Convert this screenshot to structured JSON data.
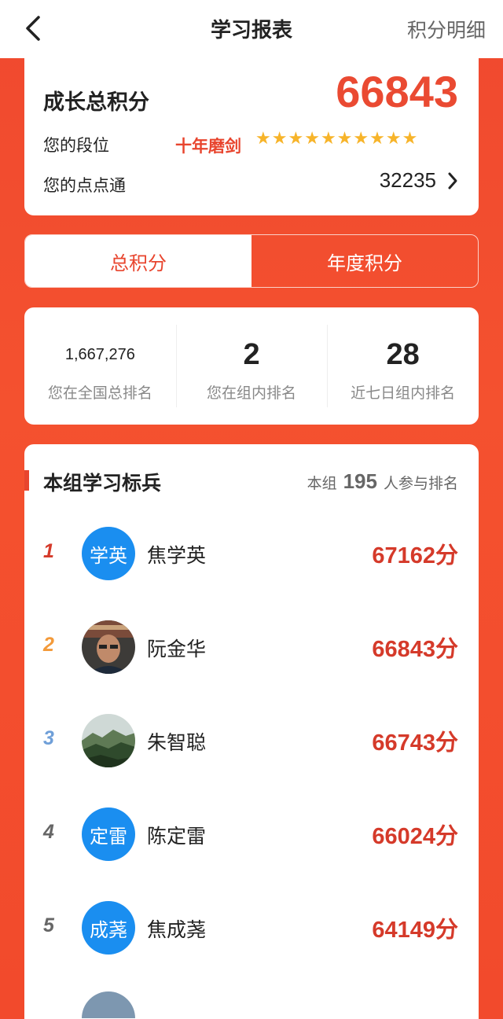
{
  "header": {
    "title": "学习报表",
    "detail_link": "积分明细"
  },
  "summary": {
    "total_label": "成长总积分",
    "total_value": "66843",
    "rank_label": "您的段位",
    "rank_title": "十年磨剑",
    "star_count": 10,
    "points_label": "您的点点通",
    "points_value": "32235"
  },
  "tabs": [
    {
      "label": "总积分",
      "active": true
    },
    {
      "label": "年度积分",
      "active": false
    }
  ],
  "rankings": [
    {
      "value": "1,667,276",
      "caption": "您在全国总排名"
    },
    {
      "value": "2",
      "caption": "您在组内排名"
    },
    {
      "value": "28",
      "caption": "近七日组内排名"
    }
  ],
  "leaderboard": {
    "title": "本组学习标兵",
    "group_prefix": "本组",
    "group_count": "195",
    "group_suffix": "人参与排名",
    "rows": [
      {
        "rank": "1",
        "rank_color": "#d53a2a",
        "avatar_type": "text",
        "avatar_text": "学英",
        "name": "焦学英",
        "score": "67162分"
      },
      {
        "rank": "2",
        "rank_color": "#f39a3a",
        "avatar_type": "photo-portrait",
        "avatar_text": "",
        "name": "阮金华",
        "score": "66843分"
      },
      {
        "rank": "3",
        "rank_color": "#6f9fd8",
        "avatar_type": "photo-landscape",
        "avatar_text": "",
        "name": "朱智聪",
        "score": "66743分"
      },
      {
        "rank": "4",
        "rank_color": "#666666",
        "avatar_type": "text",
        "avatar_text": "定雷",
        "name": "陈定雷",
        "score": "66024分"
      },
      {
        "rank": "5",
        "rank_color": "#666666",
        "avatar_type": "text",
        "avatar_text": "成荛",
        "name": "焦成荛",
        "score": "64149分"
      }
    ]
  }
}
